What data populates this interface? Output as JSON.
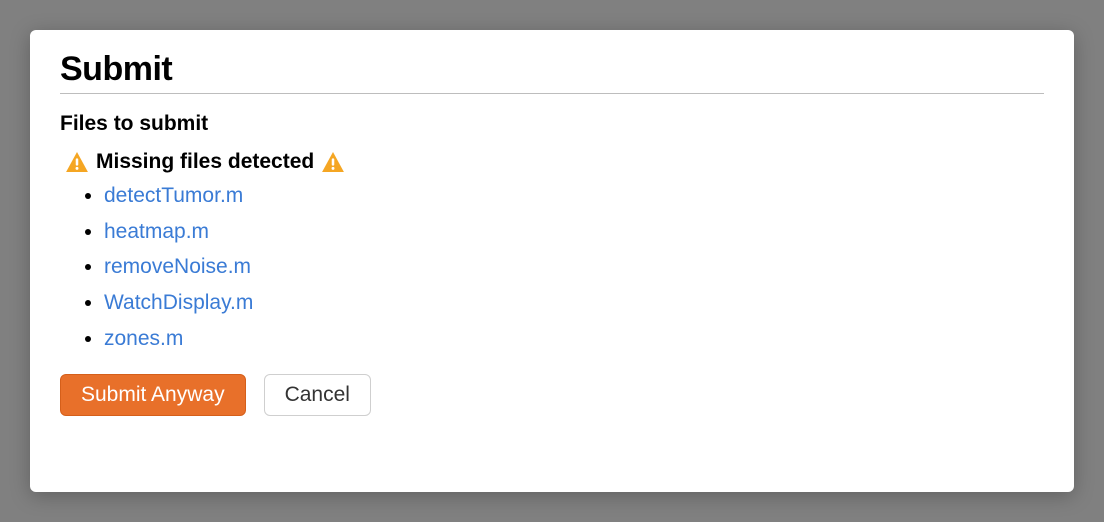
{
  "modal": {
    "title": "Submit",
    "subheading": "Files to submit",
    "warning_text": "Missing files detected",
    "files": [
      "detectTumor.m",
      "heatmap.m",
      "removeNoise.m",
      "WatchDisplay.m",
      "zones.m"
    ],
    "buttons": {
      "submit": "Submit Anyway",
      "cancel": "Cancel"
    }
  }
}
